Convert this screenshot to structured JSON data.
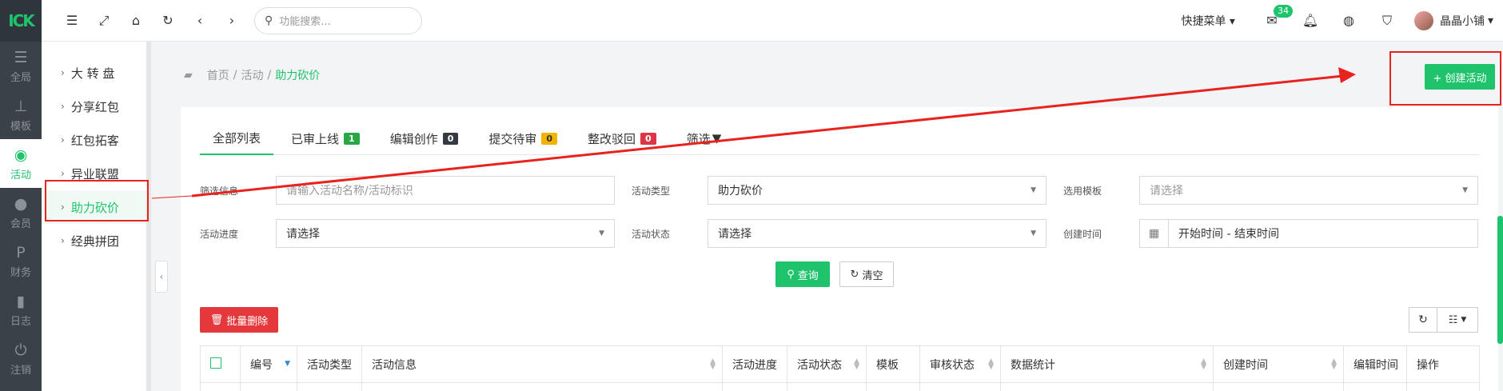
{
  "rail": {
    "logo": "ICK",
    "items": [
      {
        "label": "全局",
        "icon": "sliders-icon"
      },
      {
        "label": "模板",
        "icon": "sitemap-icon"
      },
      {
        "label": "活动",
        "icon": "broadcast-icon",
        "active": true
      },
      {
        "label": "会员",
        "icon": "users-icon"
      },
      {
        "label": "财务",
        "icon": "paypal-icon"
      },
      {
        "label": "日志",
        "icon": "shield-icon"
      },
      {
        "label": "注销",
        "icon": "power-icon"
      }
    ]
  },
  "topbar": {
    "search_placeholder": "功能搜索...",
    "quick_menu": "快捷菜单",
    "mail_count": "34",
    "username": "晶晶小铺"
  },
  "submenu": {
    "items": [
      {
        "label": "大 转 盘"
      },
      {
        "label": "分享红包"
      },
      {
        "label": "红包拓客"
      },
      {
        "label": "异业联盟"
      },
      {
        "label": "助力砍价",
        "active": true
      },
      {
        "label": "经典拼团"
      }
    ]
  },
  "breadcrumb": {
    "home": "首页",
    "sep": "/",
    "level2": "活动",
    "current": "助力砍价"
  },
  "create_button": "+ 创建活动",
  "tabs": [
    {
      "label": "全部列表",
      "active": true
    },
    {
      "label": "已审上线",
      "count": "1",
      "color": "#28a745"
    },
    {
      "label": "编辑创作",
      "count": "0",
      "color": "#343a40"
    },
    {
      "label": "提交待审",
      "count": "0",
      "color": "#f0b400"
    },
    {
      "label": "整改驳回",
      "count": "0",
      "color": "#dc3545"
    },
    {
      "label": "筛选"
    }
  ],
  "filters": {
    "info_label": "筛选信息",
    "info_placeholder": "请输入活动名称/活动标识",
    "type_label": "活动类型",
    "type_value": "助力砍价",
    "template_label": "选用模板",
    "template_placeholder": "请选择",
    "progress_label": "活动进度",
    "progress_placeholder": "请选择",
    "status_label": "活动状态",
    "status_placeholder": "请选择",
    "created_label": "创建时间",
    "created_placeholder": "开始时间 - 结束时间"
  },
  "buttons": {
    "query": "查询",
    "clear": "清空",
    "bulk_delete": "批量删除"
  },
  "table": {
    "columns": [
      "编号",
      "活动类型",
      "活动信息",
      "活动进度",
      "活动状态",
      "模板",
      "审核状态",
      "数据统计",
      "创建时间",
      "编辑时间",
      "操作"
    ]
  },
  "colors": {
    "accent": "#1fc36c",
    "annotation": "#e8231e"
  }
}
